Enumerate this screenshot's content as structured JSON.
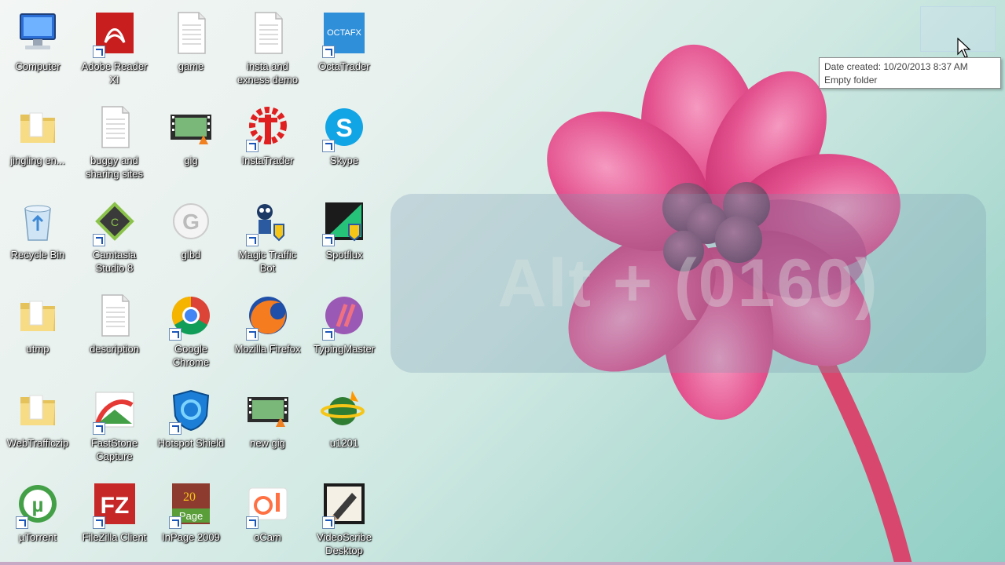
{
  "desktop": {
    "icons": [
      {
        "label": "Computer",
        "icon": "computer-icon"
      },
      {
        "label": "Adobe Reader XI",
        "icon": "adobe-reader-icon"
      },
      {
        "label": "game",
        "icon": "text-document-icon"
      },
      {
        "label": "insta and exness demo",
        "icon": "text-document-icon"
      },
      {
        "label": "OctaTrader",
        "icon": "octafx-icon"
      },
      {
        "label": "jingling en...",
        "icon": "folder-icon"
      },
      {
        "label": "buggy and sharing sites",
        "icon": "text-document-icon"
      },
      {
        "label": "gig",
        "icon": "video-file-icon"
      },
      {
        "label": "InstaTrader",
        "icon": "instaforex-icon"
      },
      {
        "label": "Skype",
        "icon": "skype-icon"
      },
      {
        "label": "Recycle Bin",
        "icon": "recycle-bin-icon"
      },
      {
        "label": "Camtasia Studio 8",
        "icon": "camtasia-icon"
      },
      {
        "label": "glbd",
        "icon": "glbd-icon"
      },
      {
        "label": "Magic Traffic Bot",
        "icon": "robot-icon"
      },
      {
        "label": "Spotflux",
        "icon": "spotflux-icon"
      },
      {
        "label": "utmp",
        "icon": "folder-icon"
      },
      {
        "label": "description",
        "icon": "text-document-icon"
      },
      {
        "label": "Google Chrome",
        "icon": "chrome-icon"
      },
      {
        "label": "Mozilla Firefox",
        "icon": "firefox-icon"
      },
      {
        "label": "TypingMaster",
        "icon": "typingmaster-icon"
      },
      {
        "label": "WebTrafficzip",
        "icon": "folder-icon"
      },
      {
        "label": "FastStone Capture",
        "icon": "faststone-icon"
      },
      {
        "label": "Hotspot Shield",
        "icon": "hotspot-shield-icon"
      },
      {
        "label": "new gig",
        "icon": "video-file-icon"
      },
      {
        "label": "u1201",
        "icon": "globe-icon"
      },
      {
        "label": "µTorrent",
        "icon": "utorrent-icon"
      },
      {
        "label": "FileZilla Client",
        "icon": "filezilla-icon"
      },
      {
        "label": "InPage 2009",
        "icon": "inpage-icon"
      },
      {
        "label": "oCam",
        "icon": "ocam-icon"
      },
      {
        "label": "VideoScribe Desktop",
        "icon": "videoscribe-icon"
      }
    ]
  },
  "overlay": {
    "text": "Alt + (0160)"
  },
  "tooltip": {
    "line1": "Date created: 10/20/2013 8:37 AM",
    "line2": "Empty folder"
  },
  "colors": {
    "flower": "#e8508f",
    "stem": "#d8486e",
    "accent": "#1a55b8"
  }
}
